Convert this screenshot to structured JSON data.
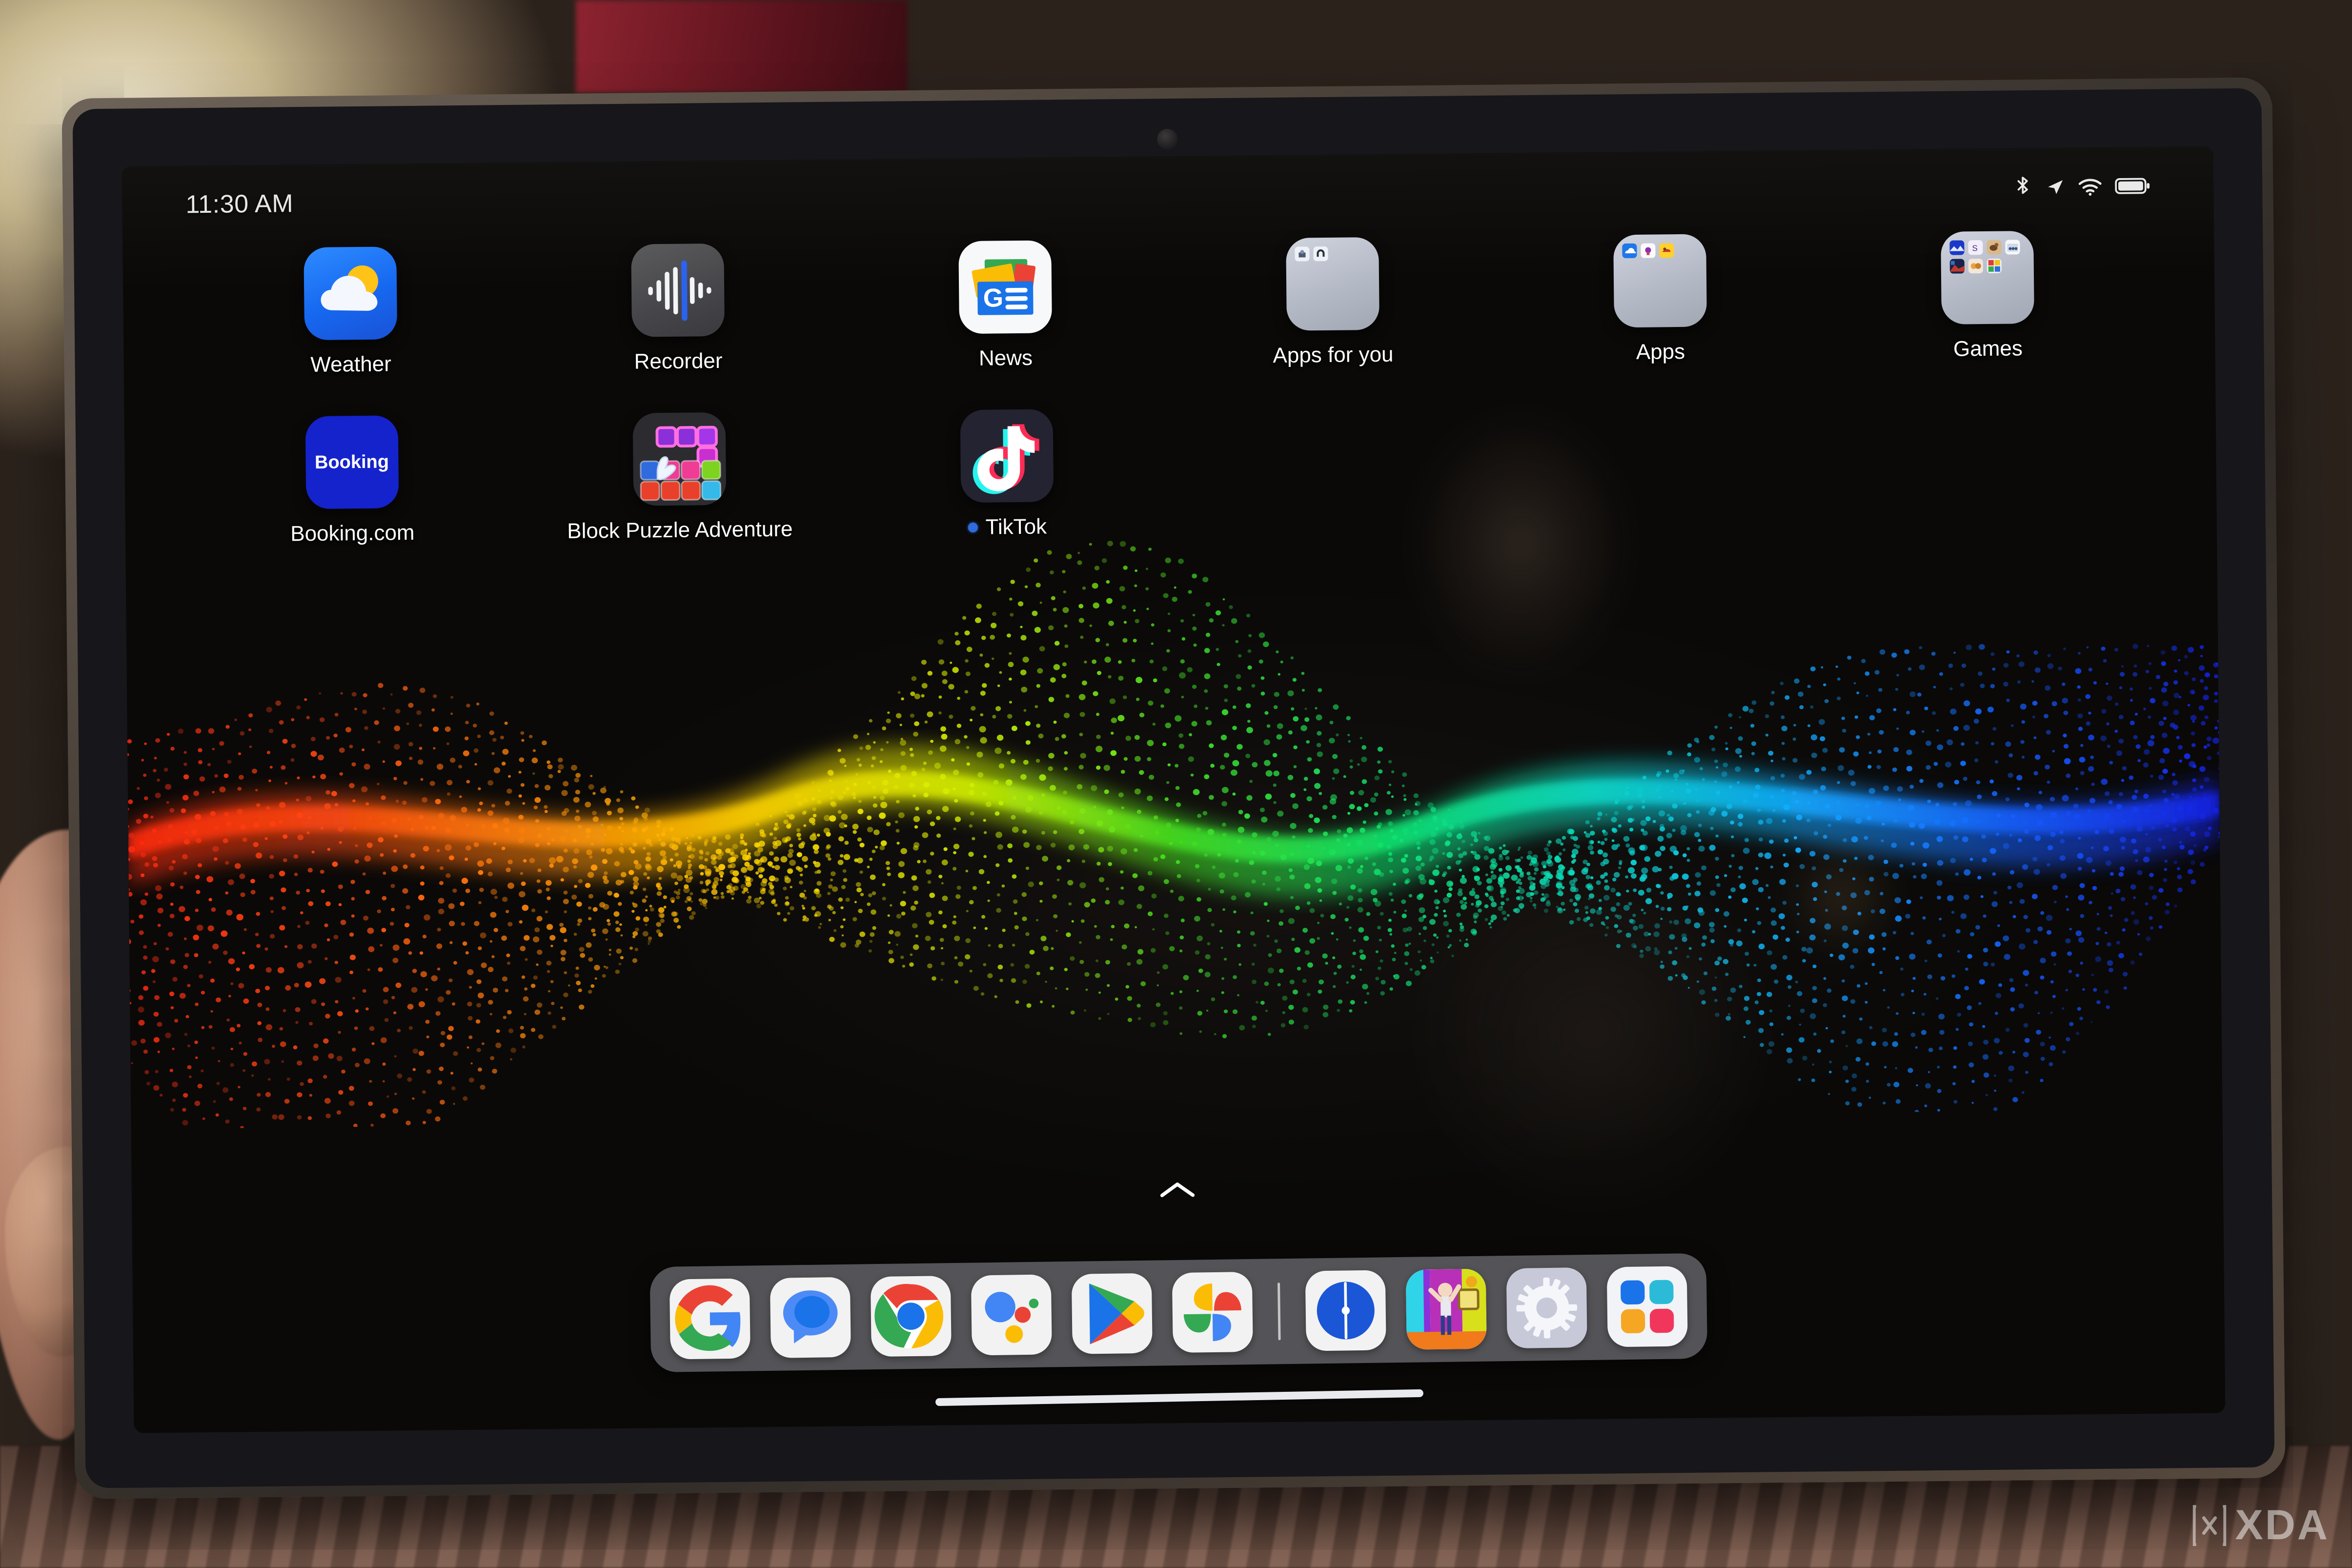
{
  "device": {
    "type": "android-tablet",
    "screen_mode": "home-screen"
  },
  "status_bar": {
    "clock": "11:30 AM",
    "icons": [
      {
        "name": "bluetooth-icon",
        "label": "Bluetooth"
      },
      {
        "name": "location-icon",
        "label": "Location"
      },
      {
        "name": "wifi-icon",
        "label": "Wi-Fi"
      },
      {
        "name": "battery-icon",
        "label": "Battery full"
      }
    ]
  },
  "home_screen": {
    "apps": [
      {
        "name": "weather",
        "label": "Weather",
        "icon": "weather-icon",
        "badge": false
      },
      {
        "name": "recorder",
        "label": "Recorder",
        "icon": "recorder-icon",
        "badge": false
      },
      {
        "name": "news",
        "label": "News",
        "icon": "google-news-icon",
        "badge": false
      },
      {
        "name": "apps-for-you",
        "label": "Apps for you",
        "icon": "folder-icon",
        "badge": false,
        "folder": true,
        "folder_items": 2
      },
      {
        "name": "apps",
        "label": "Apps",
        "icon": "folder-icon",
        "badge": false,
        "folder": true,
        "folder_items": 3
      },
      {
        "name": "games",
        "label": "Games",
        "icon": "folder-icon",
        "badge": false,
        "folder": true,
        "folder_items": 7
      },
      {
        "name": "booking",
        "label": "Booking.com",
        "icon": "booking-icon",
        "badge": false
      },
      {
        "name": "block-puzzle",
        "label": "Block Puzzle Adventure",
        "icon": "block-puzzle-icon",
        "badge": false
      },
      {
        "name": "tiktok",
        "label": "TikTok",
        "icon": "tiktok-icon",
        "badge": true
      }
    ],
    "booking_icon_text": "Booking",
    "news_icon_text": "G"
  },
  "dock": {
    "items": [
      {
        "name": "google",
        "label": "Google",
        "icon": "google-g-icon"
      },
      {
        "name": "messages",
        "label": "Messages",
        "icon": "messages-icon"
      },
      {
        "name": "chrome",
        "label": "Chrome",
        "icon": "chrome-icon"
      },
      {
        "name": "assistant",
        "label": "Google Assistant",
        "icon": "assistant-icon"
      },
      {
        "name": "play-store",
        "label": "Play Store",
        "icon": "play-store-icon"
      },
      {
        "name": "photos",
        "label": "Photos",
        "icon": "google-photos-icon"
      },
      {
        "name": "clock",
        "label": "Clock",
        "icon": "clock-icon"
      },
      {
        "name": "game",
        "label": "Game",
        "icon": "game-icon"
      },
      {
        "name": "settings",
        "label": "Settings",
        "icon": "gear-icon"
      },
      {
        "name": "app-drawer",
        "label": "All apps",
        "icon": "app-grid-icon"
      }
    ],
    "has_divider_after": 6
  },
  "gestures": {
    "drawer_handle": "chevron-up-icon",
    "home_indicator": "home-indicator-bar"
  },
  "watermark": {
    "text": "XDA"
  },
  "colors": {
    "dock_background": "#5c5c60",
    "folder_background": "#b4b9c6",
    "notification_dot": "#2f6bdd",
    "label_text": "#ffffff",
    "status_text": "#e7e7e7",
    "booking_blue": "#1523cc",
    "tiktok_dark": "#232331",
    "google_blue": "#4285f4",
    "google_red": "#ea4335",
    "google_yellow": "#fbbc05",
    "google_green": "#34a853"
  }
}
